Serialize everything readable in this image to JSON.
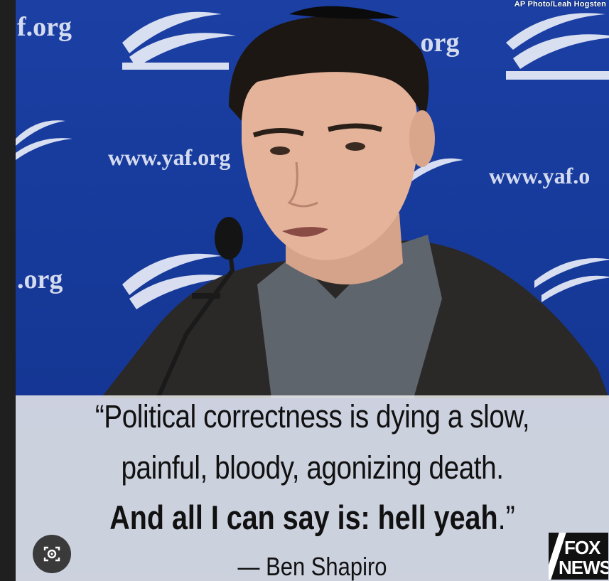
{
  "photo": {
    "credit": "AP Photo/Leah Hogsten",
    "backdrop_texts": [
      "f.org",
      ".org",
      "www.yaf.org",
      "www.yaf.o",
      ".org",
      "www.yaf.org"
    ]
  },
  "quote": {
    "line1": "“Political correctness is dying a slow,",
    "line2": "painful, bloody, agonizing death.",
    "line3_bold": "And all I can say is: hell yeah",
    "line3_tail": ".”",
    "attribution": "— Ben Shapiro"
  },
  "logo": {
    "top": "FOX",
    "bottom": "NEWS"
  },
  "icons": {
    "lens": "visual-search-icon"
  },
  "colors": {
    "backdrop": "#1b3fa3",
    "caption_bg": "#ebebeb",
    "text": "#111111"
  }
}
